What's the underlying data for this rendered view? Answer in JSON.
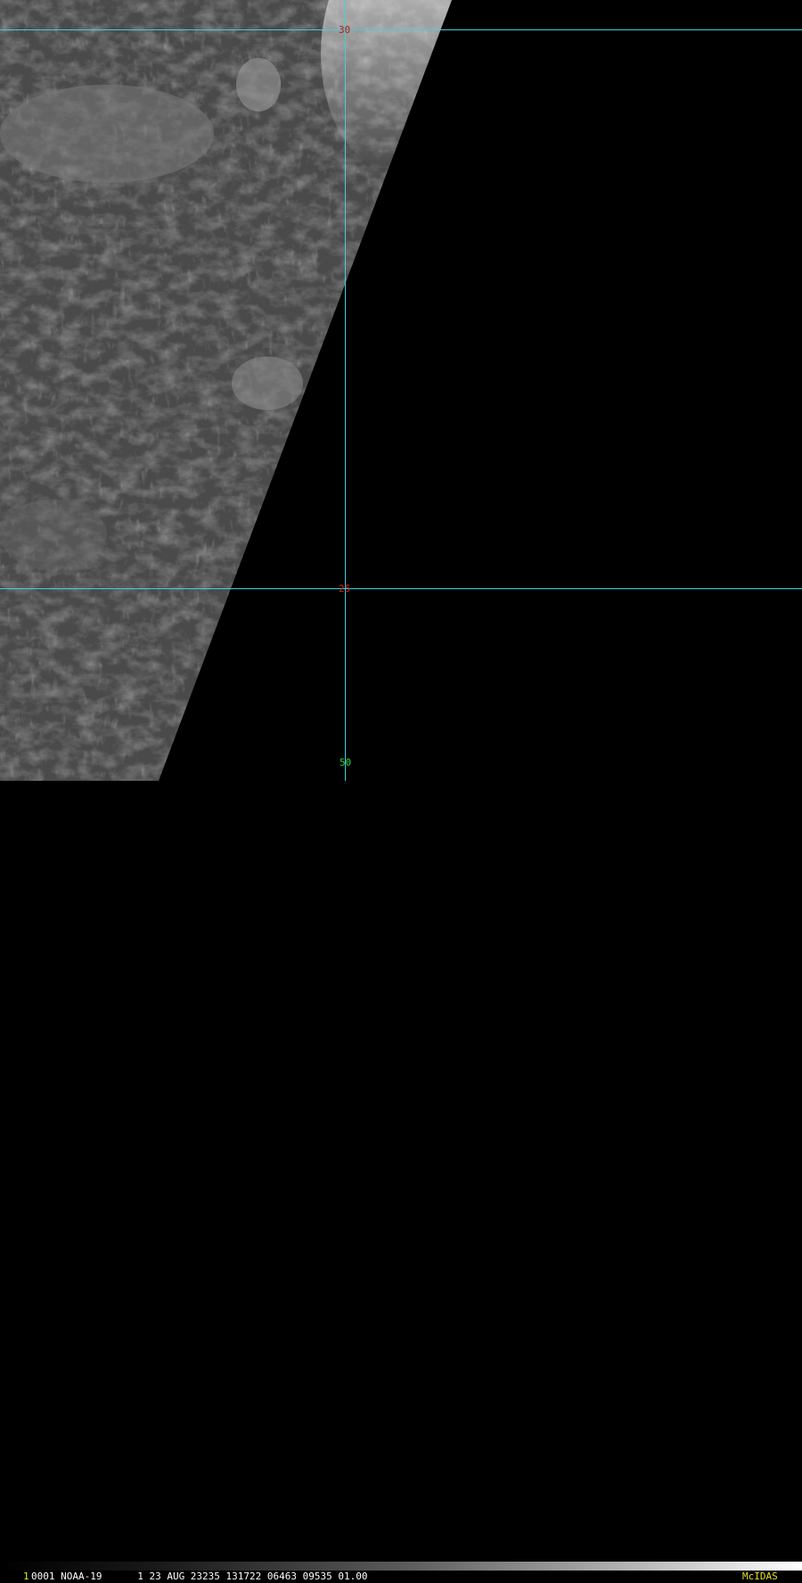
{
  "overlay": {
    "grid_color": "#3fd0d8",
    "labels": [
      {
        "id": "lat-top",
        "text": "30",
        "color": "#b02020"
      },
      {
        "id": "lat-mid",
        "text": "25",
        "color": "#d02020"
      },
      {
        "id": "lon-bottom",
        "text": "50",
        "color": "#30d040"
      }
    ]
  },
  "status": {
    "frame_number": "1",
    "frame_color": "#e0e020",
    "info": "0001 NOAA-19      1 23 AUG 23235 131722 06463 09535 01.00",
    "info_color": "#ffffff",
    "brand": "McIDAS",
    "brand_color": "#e0e020"
  }
}
